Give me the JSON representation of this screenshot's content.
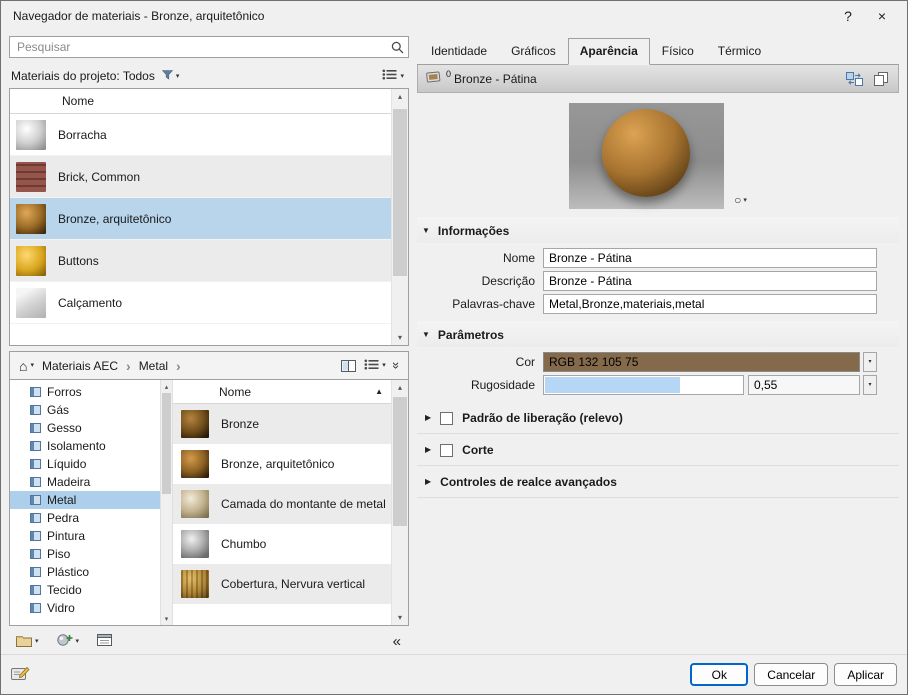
{
  "glyphs": {
    "help": "?",
    "close": "×",
    "caret": "▾",
    "chevron": "›",
    "home": "⌂",
    "collapse_left": "«",
    "chevrons_down": "»",
    "sort_asc": "▲",
    "section_open": "▼",
    "section_closed": "▶",
    "circle": "○",
    "scroll_up": "▴",
    "scroll_down": "▾"
  },
  "window": {
    "title": "Navegador de materiais - Bronze, arquitetônico"
  },
  "left_panel": {
    "search_placeholder": "Pesquisar",
    "project_filter_label": "Materiais do projeto: Todos",
    "list_header": "Nome",
    "materials": [
      {
        "name": "Borracha"
      },
      {
        "name": "Brick, Common"
      },
      {
        "name": "Bronze, arquitetônico",
        "selected": true
      },
      {
        "name": "Buttons"
      },
      {
        "name": "Calçamento"
      }
    ],
    "breadcrumb": [
      "Materiais AEC",
      "Metal"
    ],
    "tree": [
      "Forros",
      "Gás",
      "Gesso",
      "Isolamento",
      "Líquido",
      "Madeira",
      "Metal",
      "Pedra",
      "Pintura",
      "Piso",
      "Plástico",
      "Tecido",
      "Vidro"
    ],
    "tree_selected": "Metal",
    "library_list_header": "Nome",
    "library_materials": [
      {
        "name": "Bronze"
      },
      {
        "name": "Bronze, arquitetônico"
      },
      {
        "name": "Camada do montante de metal"
      },
      {
        "name": "Chumbo"
      },
      {
        "name": "Cobertura, Nervura vertical"
      }
    ]
  },
  "right_panel": {
    "tabs": [
      {
        "label": "Identidade"
      },
      {
        "label": "Gráficos"
      },
      {
        "label": "Aparência",
        "active": true
      },
      {
        "label": "Físico"
      },
      {
        "label": "Térmico"
      }
    ],
    "asset": {
      "use_count": "0",
      "name": "Bronze - Pátina"
    },
    "informacoes": {
      "title": "Informações",
      "fields": [
        {
          "label": "Nome",
          "value": "Bronze - Pátina"
        },
        {
          "label": "Descrição",
          "value": "Bronze - Pátina"
        },
        {
          "label": "Palavras-chave",
          "value": "Metal,Bronze,materiais,metal"
        }
      ]
    },
    "parametros": {
      "title": "Parâmetros",
      "cor_label": "Cor",
      "cor_value": "RGB 132 105 75",
      "cor_hex": "#84694B",
      "rugosidade_label": "Rugosidade",
      "rugosidade_value": "0,55",
      "rugosidade_fill_pct": 68
    },
    "collapsed_sections": [
      {
        "title": "Padrão de liberação (relevo)",
        "has_checkbox": true
      },
      {
        "title": "Corte",
        "has_checkbox": true
      },
      {
        "title": "Controles de realce avançados",
        "has_checkbox": false
      }
    ],
    "buttons": {
      "ok": "Ok",
      "cancel": "Cancelar",
      "apply": "Aplicar"
    }
  }
}
